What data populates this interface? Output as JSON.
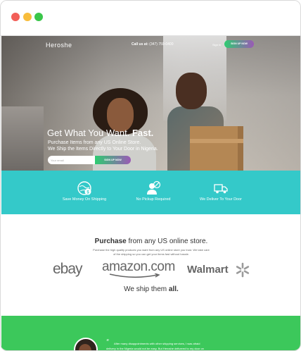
{
  "window": {
    "controls": [
      "close",
      "minimize",
      "maximize"
    ],
    "control_colors": [
      "#f25f58",
      "#f8bd3c",
      "#3ac64a"
    ]
  },
  "nav": {
    "logo": "Heroshe",
    "call_label": "Call us at:",
    "call_number": "(347) 759-0400",
    "signin": "Sign in",
    "cta": "SIGN UP NOW"
  },
  "hero": {
    "title_prefix": "Get What You Want.",
    "title_bold": "Fast.",
    "subtitle_line1": "Purchase Items from any US Online Store.",
    "subtitle_line2": "We Ship the Items Directly to Your Door in Nigeria.",
    "email_placeholder": "Your email",
    "cta": "SIGN UP NOW"
  },
  "features": [
    {
      "icon": "money-globe-icon",
      "label": "Save Money On Shipping"
    },
    {
      "icon": "no-pickup-person-icon",
      "label": "No Pickup Required"
    },
    {
      "icon": "delivery-truck-icon",
      "label": "We Deliver To Your Door"
    }
  ],
  "purchase": {
    "title_bold": "Purchase",
    "title_rest": "from any US online store.",
    "desc_line1": "Purchase the high quality products you want from any US online store you trust. We take care",
    "desc_line2": "of the shipping so you can get your items fast without hassle.",
    "stores": [
      "ebay",
      "amazon.com",
      "Walmart"
    ],
    "ship_prefix": "We ship them",
    "ship_bold": "all."
  },
  "testimonial": {
    "quote_mark": "“",
    "line1": "After many disappointments with other shipping services, I was afraid",
    "line2": "delivery in the Nigeria would not be easy. But Heroshe delivered to my door on"
  },
  "colors": {
    "teal": "#34c9c9",
    "green": "#3cc85b",
    "cta_gradient_start": "#2ecc71",
    "cta_gradient_end": "#9b59b6"
  }
}
